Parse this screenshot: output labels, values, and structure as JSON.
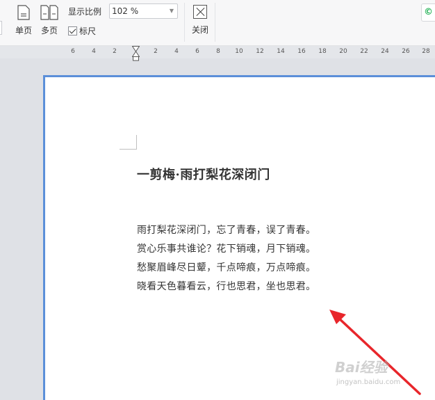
{
  "toolbar": {
    "single_page_label": "单页",
    "multi_page_label": "多页",
    "zoom_label": "显示比例",
    "zoom_value": "102 %",
    "ruler_label": "标尺",
    "ruler_checked": true,
    "close_label": "关闭",
    "right_button_glyph": "©"
  },
  "ruler": {
    "ticks": [
      "6",
      "4",
      "2",
      "2",
      "4",
      "6",
      "8",
      "10",
      "12",
      "14",
      "16",
      "18",
      "20",
      "22",
      "24",
      "26",
      "28"
    ]
  },
  "document": {
    "title": "一剪梅·雨打梨花深闭门",
    "lines": [
      "雨打梨花深闭门，忘了青春，误了青春。",
      "赏心乐事共谁论？花下销魂，月下销魂。",
      "愁聚眉峰尽日颦，千点啼痕，万点啼痕。",
      "晓看天色暮看云，行也思君，坐也思君。"
    ]
  },
  "watermark": {
    "main": "Bai经验",
    "sub": "jingyan.baidu.com"
  },
  "colors": {
    "page_border": "#5b8fd9",
    "arrow": "#e8262b",
    "toolbar_bg": "#f7f7f8",
    "workspace_bg": "#dfe1e6"
  }
}
